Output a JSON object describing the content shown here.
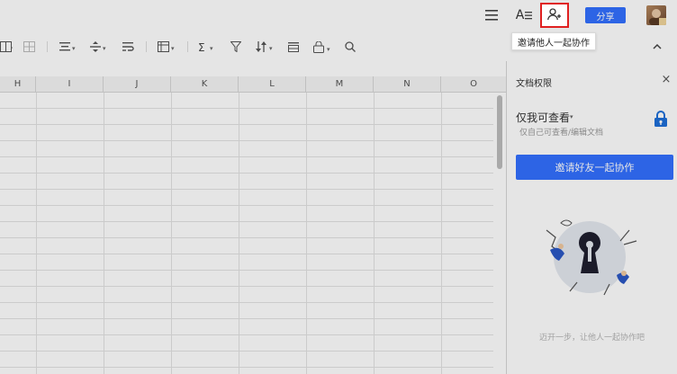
{
  "topbar": {
    "font_label": "A",
    "share_label": "分享"
  },
  "tooltip": {
    "text": "邀请他人一起协作"
  },
  "columns": [
    "H",
    "I",
    "J",
    "K",
    "L",
    "M",
    "N",
    "O"
  ],
  "panel": {
    "title": "文档权限",
    "close_glyph": "×",
    "permission_title": "仅我可查看",
    "permission_caret": "▾",
    "permission_desc": "仅自己可查看/编辑文档",
    "invite_button": "邀请好友一起协作",
    "hint": "迈开一步，让他人一起协作吧"
  },
  "colors": {
    "accent": "#3370ff",
    "highlight_border": "#e02020"
  },
  "icons": [
    "menu-icon",
    "font-size-icon",
    "add-user-icon",
    "avatar",
    "merge-icon",
    "table-icon",
    "align-icon",
    "valign-icon",
    "wrap-icon",
    "fill-icon",
    "sum-icon",
    "filter-icon",
    "sort-icon",
    "freeze-icon",
    "lock-icon",
    "search-icon",
    "chevron-up-icon",
    "close-icon"
  ]
}
